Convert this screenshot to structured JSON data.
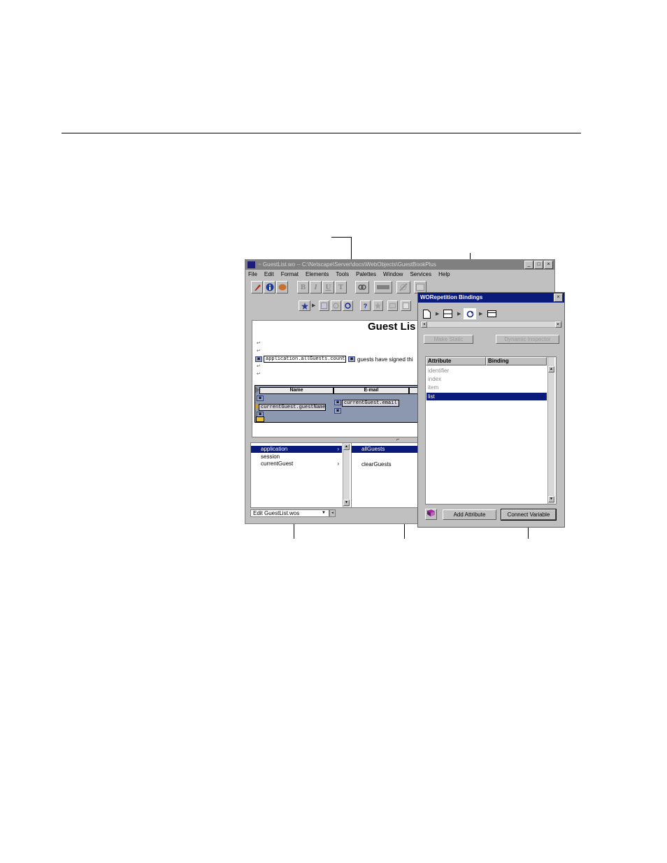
{
  "editor": {
    "title": "~ GuestList.wo  --  C:\\Netscape\\Server\\docs\\WebObjects\\GuestBookPlus",
    "window_buttons": [
      "_",
      "□",
      "×"
    ],
    "menu": [
      "File",
      "Edit",
      "Format",
      "Elements",
      "Tools",
      "Palettes",
      "Window",
      "Services",
      "Help"
    ],
    "format_buttons": [
      "B",
      "I",
      "U",
      "T"
    ],
    "element_buttons": [
      "?"
    ],
    "canvas": {
      "heading": "Guest Lis",
      "count_binding": "application.allGuests.count",
      "signed_text": "guests have signed thi",
      "columns": [
        "Name",
        "E-mail"
      ],
      "name_binding": "currentGuest.guestName",
      "email_binding": "currentGuest.email"
    },
    "browser": {
      "column1": [
        "application",
        "session",
        "currentGuest"
      ],
      "column2": [
        "allGuests",
        "clearGuests"
      ]
    },
    "status_popup": "Edit GuestList.wos"
  },
  "inspector": {
    "title": "WORepetition Bindings",
    "make_static": "Make Static",
    "dynamic_inspector": "Dynamic Inspector",
    "table_headers": [
      "Attribute",
      "Binding"
    ],
    "attributes": [
      "identifier",
      "index",
      "item",
      "list"
    ],
    "selected_attribute": "list",
    "add_attribute": "Add Attribute",
    "connect_variable": "Connect Variable"
  }
}
